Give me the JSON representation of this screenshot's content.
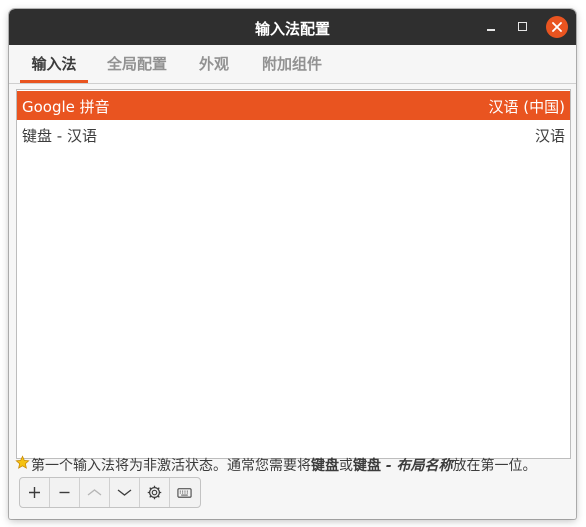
{
  "window": {
    "title": "输入法配置"
  },
  "tabs": [
    {
      "label": "输入法"
    },
    {
      "label": "全局配置"
    },
    {
      "label": "外观"
    },
    {
      "label": "附加组件"
    }
  ],
  "input_methods": [
    {
      "name": "Google 拼音",
      "language": "汉语 (中国)",
      "selected": true
    },
    {
      "name": "键盘 - 汉语",
      "language": "汉语",
      "selected": false
    }
  ],
  "hint": {
    "part1": "第一个输入法将为非激活状态。通常您需要将",
    "bold1": "键盘",
    "part2": "或",
    "bold2": "键盘",
    "italic": " - 布局名称",
    "part3": "放在第一位。"
  },
  "toolbar_icons": [
    "add-icon",
    "remove-icon",
    "move-up-icon",
    "move-down-icon",
    "configure-icon",
    "keyboard-layout-icon"
  ],
  "colors": {
    "accent": "#e95420",
    "titlebar": "#2f2f2f"
  }
}
